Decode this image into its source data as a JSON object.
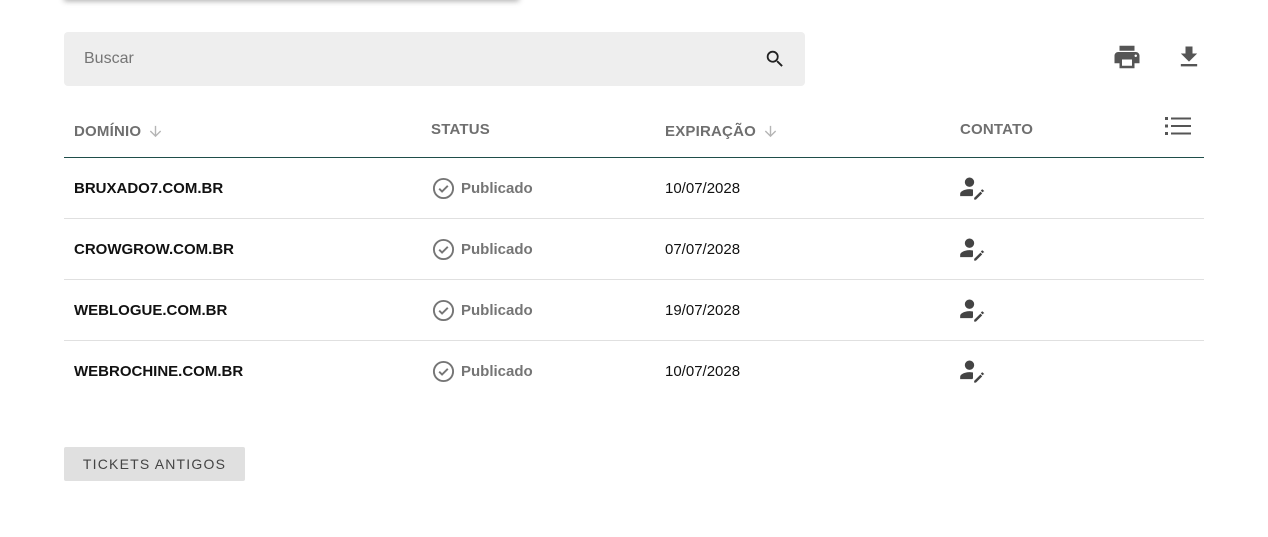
{
  "search": {
    "placeholder": "Buscar",
    "value": "",
    "icon": "search-icon"
  },
  "toolbar": {
    "print_icon": "print-icon",
    "download_icon": "download-icon"
  },
  "table": {
    "columns": {
      "domain": "DOMÍNIO",
      "status": "STATUS",
      "expiration": "EXPIRAÇÃO",
      "contact": "CONTATO"
    },
    "sort_icon": "arrow-down-icon",
    "columns_menu_icon": "list-icon",
    "rows": [
      {
        "domain": "BRUXADO7.COM.BR",
        "status": "Publicado",
        "expiration": "10/07/2028",
        "contact_icon": "person-edit-icon"
      },
      {
        "domain": "CROWGROW.COM.BR",
        "status": "Publicado",
        "expiration": "07/07/2028",
        "contact_icon": "person-edit-icon"
      },
      {
        "domain": "WEBLOGUE.COM.BR",
        "status": "Publicado",
        "expiration": "19/07/2028",
        "contact_icon": "person-edit-icon"
      },
      {
        "domain": "WEBROCHINE.COM.BR",
        "status": "Publicado",
        "expiration": "10/07/2028",
        "contact_icon": "person-edit-icon"
      }
    ]
  },
  "footer": {
    "old_tickets_label": "TICKETS ANTIGOS"
  },
  "colors": {
    "header_divider": "#1f4e4a",
    "header_text": "#6f6f6f",
    "status_text": "#757575",
    "search_bg": "#eeeeee",
    "button_bg": "#e0e0e0"
  }
}
